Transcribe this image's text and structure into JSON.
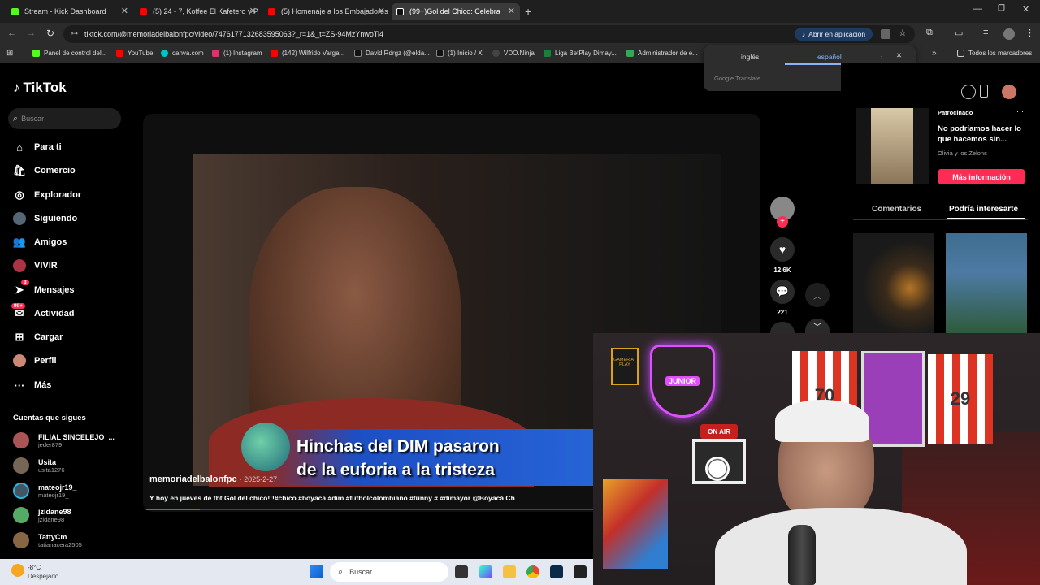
{
  "tabs": [
    {
      "label": "Stream - Kick Dashboard",
      "color": "#53fc18"
    },
    {
      "label": "(5) 24 - 7, Koffee El Kafetero y P",
      "color": "#ff0000"
    },
    {
      "label": "(5) Homenaje a los Embajadores",
      "color": "#ff0000"
    },
    {
      "label": "(99+)Gol del Chico: Celebra",
      "color": "#000000"
    }
  ],
  "address": {
    "url": "tiktok.com/@memoriadelbalonfpc/video/7476177132683595063?_r=1&_t=ZS-94MzYnwoTi4",
    "open_app": "Abrir en aplicación"
  },
  "bookmarks": [
    {
      "label": "Panel de control del...",
      "color": "#53fc18"
    },
    {
      "label": "YouTube",
      "color": "#ff0000"
    },
    {
      "label": "canva.com",
      "color": "#00c4cc"
    },
    {
      "label": "(1) Instagram",
      "color": "#e1306c"
    },
    {
      "label": "(142) Wilfrido Varga...",
      "color": "#ff0000"
    },
    {
      "label": "David Rdrgz (@elda...",
      "color": "#111111"
    },
    {
      "label": "(1) Inicio / X",
      "color": "#111111"
    },
    {
      "label": "VDO.Ninja",
      "color": "#444444"
    },
    {
      "label": "Liga BetPlay Dimay...",
      "color": "#1a7f37"
    },
    {
      "label": "Administrador de e...",
      "color": "#34a853"
    }
  ],
  "bookmarks_all": "Todos los marcadores",
  "translate": {
    "lang1": "inglés",
    "lang2": "español",
    "brand": "Google Translate"
  },
  "tiktok": {
    "logo": "TikTok",
    "search_placeholder": "Buscar",
    "nav": [
      {
        "label": "Para ti",
        "icon": "home-icon"
      },
      {
        "label": "Comercio",
        "icon": "shop-icon"
      },
      {
        "label": "Explorador",
        "icon": "compass-icon"
      },
      {
        "label": "Siguiendo",
        "icon": "following-icon"
      },
      {
        "label": "Amigos",
        "icon": "friends-icon"
      },
      {
        "label": "VIVIR",
        "icon": "live-icon"
      },
      {
        "label": "Mensajes",
        "icon": "messages-icon",
        "badge": "3"
      },
      {
        "label": "Actividad",
        "icon": "activity-icon",
        "badge": "99+"
      },
      {
        "label": "Cargar",
        "icon": "upload-icon"
      },
      {
        "label": "Perfil",
        "icon": "profile-icon"
      },
      {
        "label": "Más",
        "icon": "more-icon"
      }
    ],
    "following_title": "Cuentas que sigues",
    "following": [
      {
        "name": "FILIAL SINCELEJO_...",
        "handle": "jeder879"
      },
      {
        "name": "Usita",
        "handle": "usita1276"
      },
      {
        "name": "mateojr19_",
        "handle": "mateojr19_"
      },
      {
        "name": "jzidane98",
        "handle": "jzidane98"
      },
      {
        "name": "TattyCm",
        "handle": "tatianacera2505"
      }
    ],
    "video": {
      "caption_line1": "Hinchas del DIM pasaron",
      "caption_line2": "de la euforia a la tristeza",
      "author": "memoriadelbalonfpc",
      "date": "· 2025-2-27",
      "description": "Y hoy en jueves de tbt Gol del chico!!!#chico #boyaca #dim #futbolcolombiano #funny # #dimayor @Boyacá Ch",
      "likes": "12.6K",
      "comments": "221",
      "progress": 0.12
    },
    "ad": {
      "label": "Patrocinado",
      "title": "No podríamos hacer lo que hacemos sin...",
      "advertiser": "Olivia y los Zelons",
      "cta": "Más información"
    },
    "right_tabs": [
      "Comentarios",
      "Podría interesarte"
    ]
  },
  "weather": {
    "temp": "-8°C",
    "desc": "Despejado"
  },
  "taskbar": {
    "search": "Buscar"
  },
  "cam": {
    "sign1": "JUNIOR",
    "sign2": "ON AIR",
    "sign3": "GAMER AT PLAY",
    "jersey1": "70",
    "jersey2": "29"
  }
}
